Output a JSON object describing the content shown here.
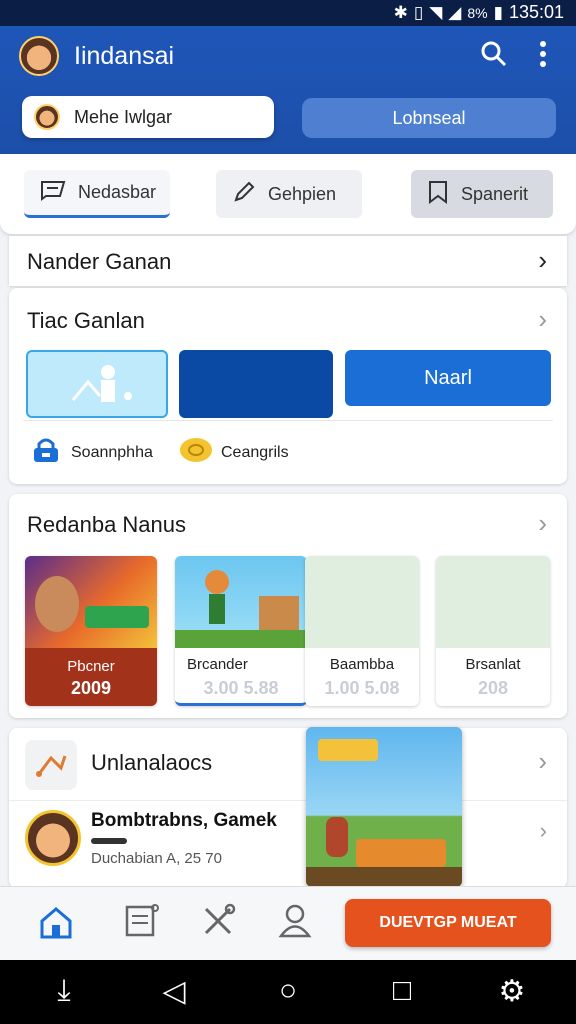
{
  "status_bar": {
    "battery": "8%",
    "time": "135:01"
  },
  "app_bar": {
    "title": "Iindansai",
    "profile_pill_label": "Mehe Iwlgar",
    "secondary_pill_label": "Lobnseal"
  },
  "tabs": [
    {
      "label": "Nedasbar",
      "icon": "chat-icon",
      "active": true
    },
    {
      "label": "Gehpien",
      "icon": "pen-icon",
      "active": false
    },
    {
      "label": "Spanerit",
      "icon": "bookmark-icon",
      "active": false
    }
  ],
  "section_one": {
    "title": "Nander Ganan"
  },
  "section_two": {
    "title": "Tiac Ganlan",
    "button_right_label": "Naarl",
    "chips": [
      {
        "label": "Soannphha",
        "icon": "lock-icon"
      },
      {
        "label": "Ceangrils",
        "icon": "coin-icon"
      }
    ]
  },
  "section_three": {
    "title": "Redanba Nanus",
    "games": [
      {
        "caption": "Pbcner",
        "value": "2009"
      },
      {
        "caption": "Brcander",
        "value": "3.00 5.88"
      },
      {
        "caption": "Baambba",
        "value": "1.00 5.08"
      },
      {
        "caption": "Brsanlat",
        "value": "208"
      }
    ]
  },
  "section_four": {
    "title": "Unlanalaocs",
    "item_title": "Bombtrabns, Gamek",
    "item_subtitle": "Duchabian A, 25 70"
  },
  "bottom_nav": {
    "cta_label": "DUEVTGP MUEAT"
  },
  "colors": {
    "primary": "#1d4fa9",
    "accent": "#2a6fd6",
    "cta": "#e5521e"
  }
}
